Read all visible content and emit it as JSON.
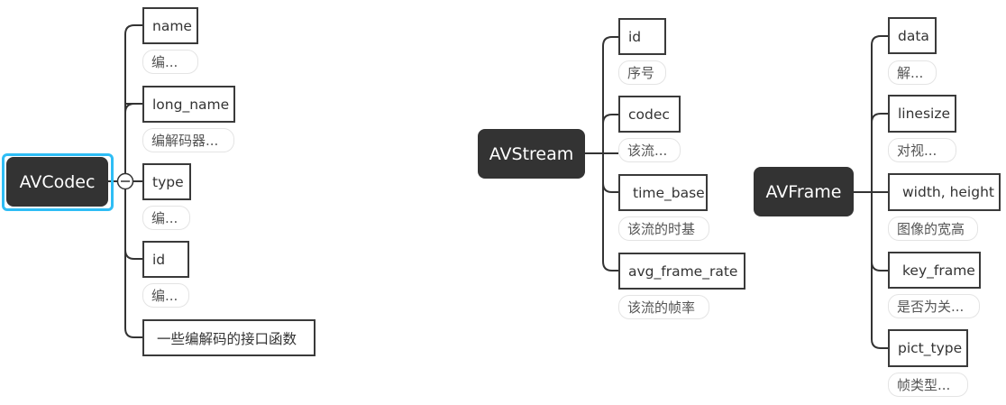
{
  "avcodec": {
    "title": "AVCodec",
    "children": [
      {
        "label": "name",
        "note": "编..."
      },
      {
        "label": "long_name",
        "note": "编解码器..."
      },
      {
        "label": "type",
        "note": "编..."
      },
      {
        "label": "id",
        "note": "编..."
      },
      {
        "label": "一些编解码的接口函数"
      }
    ]
  },
  "avstream": {
    "title": "AVStream",
    "children": [
      {
        "label": "id",
        "note": "序号"
      },
      {
        "label": "codec",
        "note": "该流..."
      },
      {
        "label": "time_base",
        "note": "该流的时基"
      },
      {
        "label": "avg_frame_rate",
        "note": "该流的帧率"
      }
    ]
  },
  "avframe": {
    "title": "AVFrame",
    "children": [
      {
        "label": "data",
        "note": "解..."
      },
      {
        "label": "linesize",
        "note": "对视..."
      },
      {
        "label": "width, height",
        "note": "图像的宽高"
      },
      {
        "label": "key_frame",
        "note": "是否为关..."
      },
      {
        "label": "pict_type",
        "note": "帧类型..."
      }
    ]
  },
  "colors": {
    "root": "#333333",
    "selection": "#2ebdf5",
    "line": "#333333"
  }
}
